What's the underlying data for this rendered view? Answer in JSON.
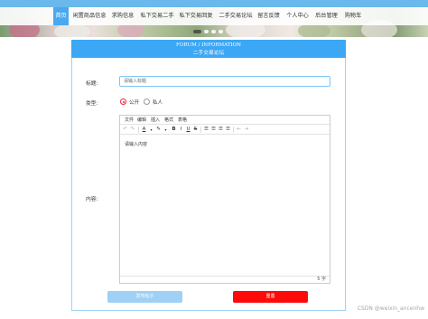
{
  "nav": {
    "items": [
      {
        "label": "首页",
        "active": true
      },
      {
        "label": "闲置商品信息",
        "active": false
      },
      {
        "label": "求购信息",
        "active": false
      },
      {
        "label": "私下交易二手",
        "active": false
      },
      {
        "label": "私下交易回复",
        "active": false
      },
      {
        "label": "二手交易论坛",
        "active": false
      },
      {
        "label": "留言反馈",
        "active": false
      },
      {
        "label": "个人中心",
        "active": false
      },
      {
        "label": "后台管理",
        "active": false
      },
      {
        "label": "购物车",
        "active": false
      }
    ]
  },
  "banner": {
    "title_en": "FORUM / INFORMATION",
    "title_cn": "二手交易论坛"
  },
  "form": {
    "title_label": "标题:",
    "title_placeholder": "请输入标题",
    "type_label": "类型:",
    "type_options": [
      {
        "label": "公开",
        "selected": true
      },
      {
        "label": "私人",
        "selected": false
      }
    ],
    "content_label": "内容:"
  },
  "editor": {
    "menus": [
      "文件",
      "编辑",
      "插入",
      "格式",
      "表格"
    ],
    "toolbar_icons": [
      "undo-icon",
      "redo-icon",
      "font-color-icon",
      "highlight-icon",
      "bold-icon",
      "italic-icon",
      "underline-icon",
      "strikethrough-icon",
      "align-left-icon",
      "align-center-icon",
      "align-right-icon",
      "align-justify-icon",
      "outdent-icon",
      "indent-icon"
    ],
    "placeholder": "请输入内容",
    "word_count": "5 字"
  },
  "buttons": {
    "submit": "发布帖子",
    "reset": "重置"
  },
  "watermark": "CSDN @weixin_ancenhw",
  "colors": {
    "accent": "#3ba7f5",
    "nav_active": "#4aa8f0",
    "submit": "#9fd0f5",
    "reset": "#ff0a0a",
    "radio_selected": "#e23"
  }
}
